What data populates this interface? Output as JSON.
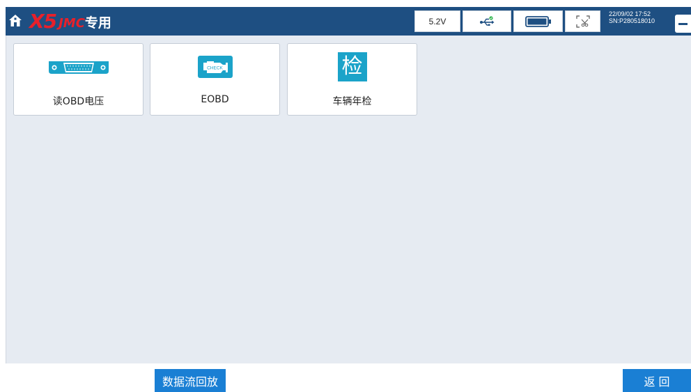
{
  "header": {
    "brand_model": "X5",
    "brand_make": "JMC",
    "brand_tag": "专用",
    "voltage": "5.2V",
    "date_time": "22/09/02 17:52",
    "serial": "SN:P280518010",
    "icons": [
      "home-icon",
      "usb-icon",
      "battery-icon",
      "screenshot-icon",
      "minimize-icon"
    ]
  },
  "tiles": [
    {
      "label": "读OBD电压",
      "icon": "obd-connector-icon"
    },
    {
      "label": "EOBD",
      "icon": "check-engine-icon",
      "icon_text": "CHECK"
    },
    {
      "label": "车辆年检",
      "icon": "inspection-icon",
      "icon_text": "检"
    }
  ],
  "footer": {
    "playback_label": "数据流回放",
    "back_label": "返回"
  },
  "colors": {
    "header_bg": "#1e4f82",
    "brand_red": "#e8202a",
    "button_blue": "#1a7fd4",
    "main_bg": "#e6ebf2",
    "icon_teal": "#1ba3c9"
  }
}
